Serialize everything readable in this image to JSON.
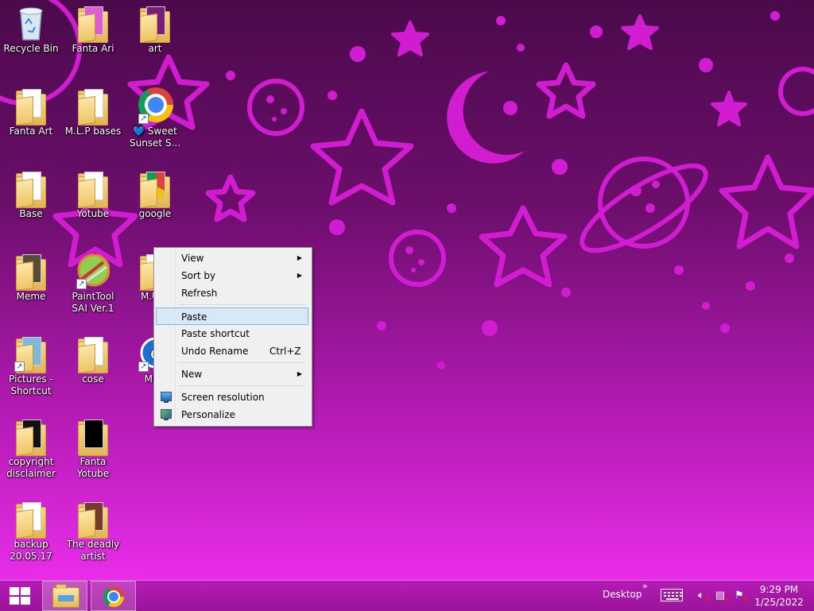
{
  "colors": {
    "accent": "#ea2dea",
    "menu_highlight": "#d9e8f7",
    "taskbar": "#a817a8"
  },
  "desktop_icons": [
    {
      "label": "Recycle Bin",
      "icon": "recycle-bin-icon"
    },
    {
      "label": "Fanta Ari",
      "icon": "folder-icon"
    },
    {
      "label": "art",
      "icon": "folder-icon"
    },
    {
      "label": "Fanta Art",
      "icon": "folder-icon"
    },
    {
      "label": "M.L.P bases",
      "icon": "folder-icon"
    },
    {
      "label": "💙 Sweet Sunset S...",
      "icon": "chrome-icon"
    },
    {
      "label": "Base",
      "icon": "folder-icon"
    },
    {
      "label": "Yotube",
      "icon": "folder-icon"
    },
    {
      "label": "google",
      "icon": "folder-icon"
    },
    {
      "label": "Meme",
      "icon": "folder-icon"
    },
    {
      "label": "PaintTool SAI Ver.1",
      "icon": "painttool-sai-icon"
    },
    {
      "label": "M.U.G",
      "icon": "folder-icon"
    },
    {
      "label": "Pictures - Shortcut",
      "icon": "pictures-shortcut-icon"
    },
    {
      "label": "cose",
      "icon": "folder-icon"
    },
    {
      "label": "M.U.",
      "icon": "app-shortcut-icon"
    },
    {
      "label": "copyright disclaimer",
      "icon": "folder-icon"
    },
    {
      "label": "Fanta Yotube",
      "icon": "folder-icon"
    },
    {
      "label": "backup 20.05.17",
      "icon": "folder-icon"
    },
    {
      "label": "The deadly artist",
      "icon": "folder-icon"
    }
  ],
  "context_menu": {
    "view": "View",
    "sort_by": "Sort by",
    "refresh": "Refresh",
    "paste": "Paste",
    "paste_shortcut": "Paste shortcut",
    "undo_rename": "Undo Rename",
    "undo_rename_shortcut": "Ctrl+Z",
    "new": "New",
    "screen_resolution": "Screen resolution",
    "personalize": "Personalize",
    "submenu_arrow": "▶"
  },
  "taskbar": {
    "desktop_label": "Desktop",
    "chevron": "»",
    "time": "9:29 PM",
    "date": "1/25/2022",
    "pinned": [
      "file-explorer-icon",
      "chrome-icon"
    ]
  }
}
